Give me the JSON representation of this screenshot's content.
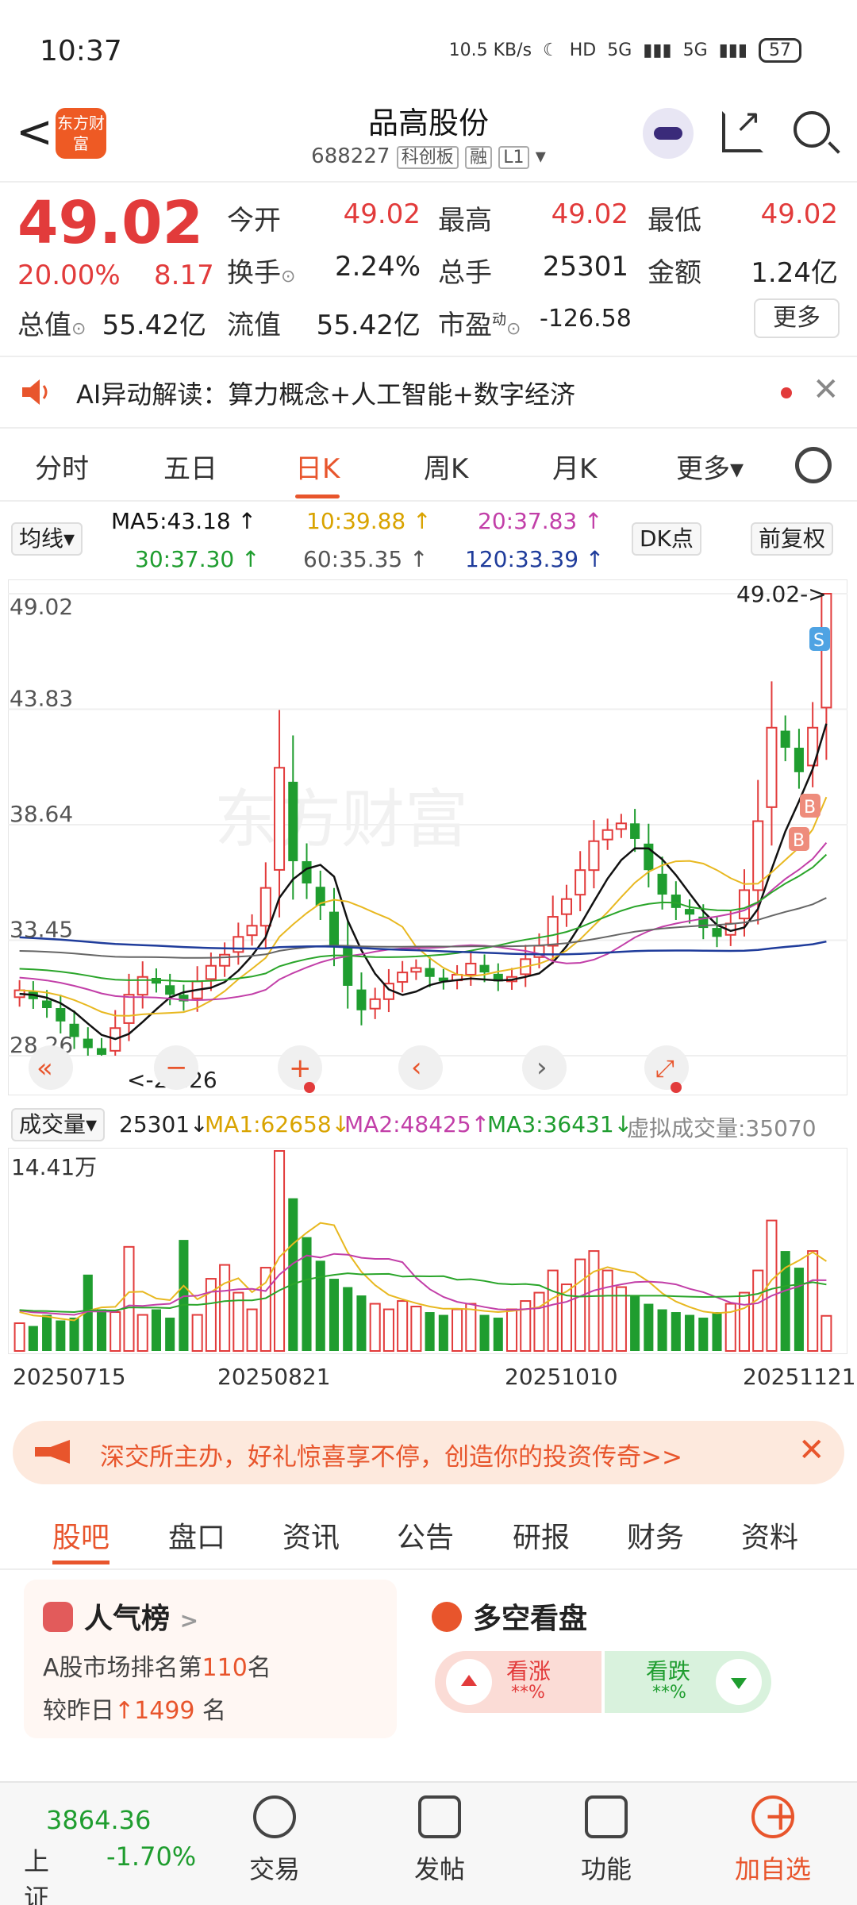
{
  "status_bar": {
    "time": "10:37",
    "net_speed": "10.5 KB/s",
    "hd": "HD",
    "sig1": "5G",
    "sig2": "5G",
    "battery": "57"
  },
  "header": {
    "back": "<",
    "logo_text": "东方财富",
    "title": "品高股份",
    "code": "688227",
    "board": "科创板",
    "margin": "融",
    "level": "L1",
    "dropdown": "▾"
  },
  "quote": {
    "price": "49.02",
    "pct": "20.00%",
    "change": "8.17",
    "open_label": "今开",
    "open": "49.02",
    "high_label": "最高",
    "high": "49.02",
    "low_label": "最低",
    "low": "49.02",
    "turnover_label": "换手",
    "turnover": "2.24%",
    "vol_label": "总手",
    "vol": "25301",
    "amount_label": "金额",
    "amount": "1.24亿",
    "mktcap_label": "总值",
    "mktcap": "55.42亿",
    "float_label": "流值",
    "float": "55.42亿",
    "pe_label": "市盈",
    "pe_sup": "动",
    "pe": "-126.58",
    "more": "更多"
  },
  "ai_banner": {
    "text": "AI异动解读：算力概念+人工智能+数字经济",
    "close": "✕"
  },
  "kline_tabs": [
    "分时",
    "五日",
    "日K",
    "周K",
    "月K",
    "更多▾"
  ],
  "kline_active": 2,
  "ma_row": {
    "type_label": "均线▾",
    "ma5": "MA5:43.18 ↑",
    "ma10": "10:39.88 ↑",
    "ma20": "20:37.83 ↑",
    "ma30": "30:37.30 ↑",
    "ma60": "60:35.35 ↑",
    "ma120": "120:33.39 ↑",
    "dk": "DK点",
    "adjust": "前复权"
  },
  "colors": {
    "up": "#e23b3b",
    "down": "#1f9d2f",
    "accent": "#e8552c",
    "ma5": "#111111",
    "ma10": "#e8b820",
    "ma20": "#c23fa8",
    "ma30": "#2aa52a",
    "ma60": "#555555",
    "ma120": "#1f3c9b"
  },
  "chart_data": [
    {
      "type": "candlestick",
      "title": "",
      "y_ticks": [
        "49.02",
        "43.83",
        "38.64",
        "33.45",
        "28.26"
      ],
      "ylim": [
        28.26,
        49.02
      ],
      "max_label": "49.02->",
      "min_label": "<-28.26",
      "watermark": "东方财富",
      "markers": [
        "S",
        "B",
        "B"
      ],
      "x": [
        "20250715",
        "20250821",
        "20251010",
        "20251121"
      ],
      "series_close": [
        31.2,
        30.8,
        30.4,
        29.8,
        29.1,
        28.6,
        28.3,
        29.5,
        31.0,
        31.8,
        31.5,
        31.0,
        30.7,
        31.6,
        32.3,
        32.8,
        33.6,
        34.1,
        35.8,
        41.2,
        37.0,
        36.0,
        35.0,
        33.2,
        31.4,
        30.3,
        30.8,
        31.5,
        32.0,
        32.2,
        31.8,
        31.6,
        31.9,
        32.4,
        32.0,
        31.6,
        31.8,
        32.6,
        33.2,
        34.5,
        35.3,
        36.6,
        37.9,
        38.4,
        38.7,
        38.0,
        36.6,
        35.5,
        34.9,
        34.6,
        34.0,
        33.6,
        34.2,
        35.7,
        38.8,
        43.0,
        42.1,
        41.0,
        43.0,
        49.02
      ],
      "ma_values": {
        "MA5": 43.18,
        "MA10": 39.88,
        "MA20": 37.83,
        "MA30": 37.3,
        "MA60": 35.35,
        "MA120": 33.39
      }
    },
    {
      "type": "bar",
      "title": "",
      "y_ticks": [
        "14.41万"
      ],
      "ylim": [
        0,
        144100
      ],
      "values": [
        20000,
        18000,
        26000,
        22000,
        24000,
        55000,
        30000,
        28000,
        75000,
        26000,
        30000,
        24000,
        80000,
        26000,
        52000,
        62000,
        42000,
        30000,
        60000,
        144100,
        110000,
        82000,
        65000,
        52000,
        46000,
        40000,
        34000,
        30000,
        36000,
        32000,
        28000,
        26000,
        30000,
        34000,
        26000,
        24000,
        30000,
        36000,
        42000,
        58000,
        48000,
        66000,
        72000,
        58000,
        46000,
        40000,
        34000,
        30000,
        28000,
        26000,
        24000,
        28000,
        34000,
        42000,
        58000,
        94000,
        72000,
        60000,
        72000,
        25301
      ]
    }
  ],
  "vol_row": {
    "label": "成交量▾",
    "vol": "25301↓",
    "ma1": "MA1:62658↓",
    "ma2": "MA2:48425↑",
    "ma3": "MA3:36431↓",
    "virtual": "虚拟成交量:35070"
  },
  "dates": [
    "20250715",
    "20250821",
    "20251010",
    "20251121"
  ],
  "promo": {
    "text": "深交所主办，好礼惊喜享不停，创造你的投资传奇>>",
    "close": "✕"
  },
  "bottom_tabs": [
    "股吧",
    "盘口",
    "资讯",
    "公告",
    "研报",
    "财务",
    "资料"
  ],
  "bottom_tab_active": 0,
  "cards": {
    "popularity": {
      "title": "人气榜",
      "arrow": ">",
      "line1_pre": "A股市场排名第",
      "rank": "110",
      "line1_post": "名",
      "line2_pre": "较昨日",
      "change": "1499",
      "line2_post": "名"
    },
    "bullbear": {
      "title": "多空看盘",
      "bull": "看涨",
      "bull_pct": "**%",
      "bear": "看跌",
      "bear_pct": "**%"
    }
  },
  "bottom_nav": {
    "index_value": "3864.36",
    "index_name": "上证",
    "index_pct": "-1.70%",
    "trade": "交易",
    "post": "发帖",
    "func": "功能",
    "add": "加自选"
  }
}
